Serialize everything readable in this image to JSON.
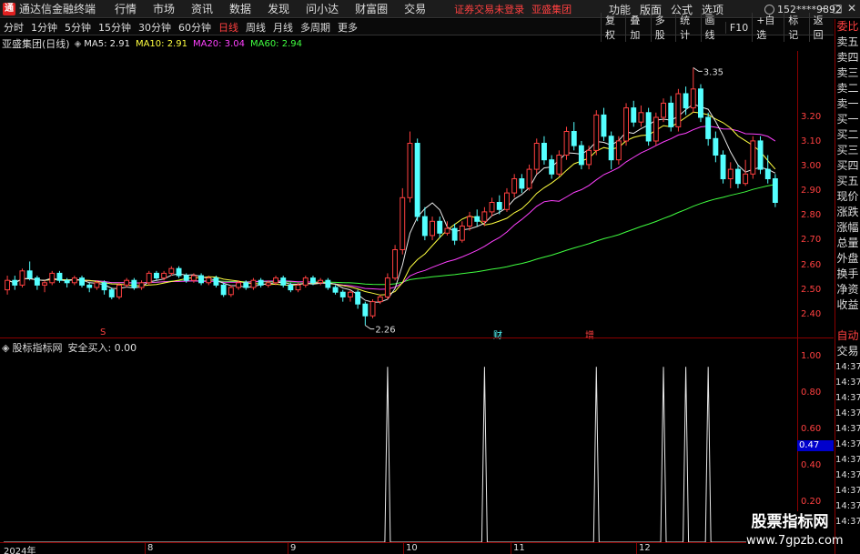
{
  "titlebar": {
    "logo": "通",
    "app_title": "通达信金融终端",
    "menu": [
      "行情",
      "市场",
      "资讯",
      "数据",
      "发现",
      "问小达",
      "财富圈",
      "交易"
    ],
    "login_status": "证券交易未登录",
    "stock_name": "亚盛集团",
    "right_menu": [
      "功能",
      "版面",
      "公式",
      "选项"
    ],
    "user_id": "152****9892",
    "window_controls": [
      "–",
      "□",
      "✕"
    ]
  },
  "toolbar": {
    "period_tabs": [
      "分时",
      "1分钟",
      "5分钟",
      "15分钟",
      "30分钟",
      "60分钟",
      "日线",
      "周线",
      "月线",
      "多周期",
      "更多"
    ],
    "active_period": "日线",
    "tool_buttons": [
      "复权",
      "叠加",
      "多股",
      "统计",
      "画线",
      "F10",
      "+自选",
      "标记",
      "返回"
    ]
  },
  "main_chart": {
    "stock_label": "亚盛集团(日线)",
    "toggle_icon": "◈",
    "ma5": "MA5: 2.91",
    "ma10": "MA10: 2.91",
    "ma20": "MA20: 3.04",
    "ma60": "MA60: 2.94",
    "price_labels": [
      "3.20",
      "3.10",
      "3.00",
      "2.90",
      "2.80",
      "2.70",
      "2.60",
      "2.50",
      "2.40"
    ],
    "high_label": "3.35",
    "low_label": "2.26",
    "events": [
      "S",
      "财",
      "增"
    ]
  },
  "indicator": {
    "toggle_icon": "◈",
    "name": "股标指标网",
    "value_label": "安全买入: 0.00",
    "axis_labels": [
      "1.00",
      "0.80",
      "0.60",
      "0.40",
      "0.20"
    ],
    "current_value": "0.47"
  },
  "date_axis": [
    "2024年",
    "8",
    "9",
    "10",
    "11",
    "12"
  ],
  "sidebar": {
    "items": [
      "委比",
      "卖五",
      "卖四",
      "卖三",
      "卖二",
      "卖一",
      "买一",
      "买二",
      "买三",
      "买四",
      "买五",
      "现价",
      "涨跌",
      "涨幅",
      "总量",
      "外盘",
      "换手",
      "净资",
      "收益",
      "",
      "自动",
      "交易"
    ],
    "times": [
      "14:37",
      "14:37",
      "14:37",
      "14:37",
      "14:37",
      "14:37",
      "14:37",
      "14:37",
      "14:37",
      "14:37",
      "14:37"
    ]
  },
  "watermark": {
    "line1": "股票指标网",
    "line2": "www.7gpzb.com"
  },
  "colors": {
    "up": "#ff4040",
    "down": "#54ffff",
    "ma5": "#e8e8e8",
    "ma10": "#ffff40",
    "ma20": "#ff40ff",
    "ma60": "#40ff40",
    "axis_red": "#8b0000"
  },
  "chart_data": [
    {
      "type": "candlestick",
      "title": "亚盛集团(日线)",
      "ylim": [
        2.22,
        3.39
      ],
      "high": 3.35,
      "low": 2.26,
      "series": [
        {
          "name": "MA5",
          "value": 2.91
        },
        {
          "name": "MA10",
          "value": 2.91
        },
        {
          "name": "MA20",
          "value": 3.04
        },
        {
          "name": "MA60",
          "value": 2.94
        }
      ],
      "candles": [
        {
          "o": 2.41,
          "c": 2.45,
          "h": 2.47,
          "l": 2.39
        },
        {
          "o": 2.45,
          "c": 2.43,
          "h": 2.47,
          "l": 2.41
        },
        {
          "o": 2.43,
          "c": 2.49,
          "h": 2.5,
          "l": 2.42
        },
        {
          "o": 2.49,
          "c": 2.46,
          "h": 2.53,
          "l": 2.45
        },
        {
          "o": 2.46,
          "c": 2.43,
          "h": 2.47,
          "l": 2.41
        },
        {
          "o": 2.43,
          "c": 2.44,
          "h": 2.45,
          "l": 2.4
        },
        {
          "o": 2.44,
          "c": 2.48,
          "h": 2.49,
          "l": 2.43
        },
        {
          "o": 2.48,
          "c": 2.45,
          "h": 2.49,
          "l": 2.44
        },
        {
          "o": 2.45,
          "c": 2.44,
          "h": 2.46,
          "l": 2.42
        },
        {
          "o": 2.44,
          "c": 2.46,
          "h": 2.47,
          "l": 2.43
        },
        {
          "o": 2.46,
          "c": 2.43,
          "h": 2.47,
          "l": 2.42
        },
        {
          "o": 2.43,
          "c": 2.42,
          "h": 2.44,
          "l": 2.4
        },
        {
          "o": 2.42,
          "c": 2.44,
          "h": 2.45,
          "l": 2.41
        },
        {
          "o": 2.44,
          "c": 2.41,
          "h": 2.45,
          "l": 2.39
        },
        {
          "o": 2.41,
          "c": 2.38,
          "h": 2.42,
          "l": 2.37
        },
        {
          "o": 2.38,
          "c": 2.43,
          "h": 2.44,
          "l": 2.37
        },
        {
          "o": 2.43,
          "c": 2.45,
          "h": 2.46,
          "l": 2.42
        },
        {
          "o": 2.45,
          "c": 2.42,
          "h": 2.46,
          "l": 2.41
        },
        {
          "o": 2.42,
          "c": 2.44,
          "h": 2.45,
          "l": 2.41
        },
        {
          "o": 2.44,
          "c": 2.48,
          "h": 2.49,
          "l": 2.43
        },
        {
          "o": 2.48,
          "c": 2.46,
          "h": 2.49,
          "l": 2.45
        },
        {
          "o": 2.46,
          "c": 2.48,
          "h": 2.49,
          "l": 2.45
        },
        {
          "o": 2.48,
          "c": 2.5,
          "h": 2.51,
          "l": 2.47
        },
        {
          "o": 2.5,
          "c": 2.47,
          "h": 2.51,
          "l": 2.46
        },
        {
          "o": 2.47,
          "c": 2.45,
          "h": 2.48,
          "l": 2.44
        },
        {
          "o": 2.45,
          "c": 2.47,
          "h": 2.48,
          "l": 2.44
        },
        {
          "o": 2.47,
          "c": 2.44,
          "h": 2.48,
          "l": 2.43
        },
        {
          "o": 2.44,
          "c": 2.46,
          "h": 2.47,
          "l": 2.43
        },
        {
          "o": 2.46,
          "c": 2.43,
          "h": 2.47,
          "l": 2.42
        },
        {
          "o": 2.43,
          "c": 2.39,
          "h": 2.44,
          "l": 2.38
        },
        {
          "o": 2.39,
          "c": 2.42,
          "h": 2.43,
          "l": 2.38
        },
        {
          "o": 2.42,
          "c": 2.44,
          "h": 2.45,
          "l": 2.41
        },
        {
          "o": 2.44,
          "c": 2.42,
          "h": 2.45,
          "l": 2.41
        },
        {
          "o": 2.42,
          "c": 2.45,
          "h": 2.46,
          "l": 2.41
        },
        {
          "o": 2.45,
          "c": 2.43,
          "h": 2.46,
          "l": 2.42
        },
        {
          "o": 2.43,
          "c": 2.44,
          "h": 2.45,
          "l": 2.42
        },
        {
          "o": 2.44,
          "c": 2.46,
          "h": 2.47,
          "l": 2.43
        },
        {
          "o": 2.46,
          "c": 2.43,
          "h": 2.47,
          "l": 2.42
        },
        {
          "o": 2.43,
          "c": 2.41,
          "h": 2.44,
          "l": 2.4
        },
        {
          "o": 2.41,
          "c": 2.43,
          "h": 2.44,
          "l": 2.4
        },
        {
          "o": 2.43,
          "c": 2.46,
          "h": 2.47,
          "l": 2.42
        },
        {
          "o": 2.46,
          "c": 2.44,
          "h": 2.47,
          "l": 2.43
        },
        {
          "o": 2.44,
          "c": 2.45,
          "h": 2.46,
          "l": 2.43
        },
        {
          "o": 2.45,
          "c": 2.42,
          "h": 2.46,
          "l": 2.41
        },
        {
          "o": 2.42,
          "c": 2.4,
          "h": 2.43,
          "l": 2.39
        },
        {
          "o": 2.4,
          "c": 2.38,
          "h": 2.41,
          "l": 2.36
        },
        {
          "o": 2.38,
          "c": 2.4,
          "h": 2.41,
          "l": 2.36
        },
        {
          "o": 2.4,
          "c": 2.35,
          "h": 2.41,
          "l": 2.33
        },
        {
          "o": 2.35,
          "c": 2.3,
          "h": 2.36,
          "l": 2.26
        },
        {
          "o": 2.3,
          "c": 2.36,
          "h": 2.37,
          "l": 2.29
        },
        {
          "o": 2.36,
          "c": 2.38,
          "h": 2.39,
          "l": 2.35
        },
        {
          "o": 2.38,
          "c": 2.46,
          "h": 2.48,
          "l": 2.37
        },
        {
          "o": 2.46,
          "c": 2.58,
          "h": 2.6,
          "l": 2.45
        },
        {
          "o": 2.58,
          "c": 2.8,
          "h": 2.84,
          "l": 2.56
        },
        {
          "o": 2.8,
          "c": 3.03,
          "h": 3.08,
          "l": 2.78
        },
        {
          "o": 3.03,
          "c": 2.72,
          "h": 3.05,
          "l": 2.7
        },
        {
          "o": 2.72,
          "c": 2.64,
          "h": 2.76,
          "l": 2.62
        },
        {
          "o": 2.64,
          "c": 2.7,
          "h": 2.72,
          "l": 2.62
        },
        {
          "o": 2.7,
          "c": 2.65,
          "h": 2.72,
          "l": 2.63
        },
        {
          "o": 2.65,
          "c": 2.67,
          "h": 2.7,
          "l": 2.64
        },
        {
          "o": 2.67,
          "c": 2.62,
          "h": 2.69,
          "l": 2.6
        },
        {
          "o": 2.62,
          "c": 2.68,
          "h": 2.7,
          "l": 2.61
        },
        {
          "o": 2.68,
          "c": 2.72,
          "h": 2.74,
          "l": 2.66
        },
        {
          "o": 2.72,
          "c": 2.7,
          "h": 2.75,
          "l": 2.68
        },
        {
          "o": 2.7,
          "c": 2.74,
          "h": 2.76,
          "l": 2.68
        },
        {
          "o": 2.74,
          "c": 2.78,
          "h": 2.8,
          "l": 2.72
        },
        {
          "o": 2.78,
          "c": 2.75,
          "h": 2.81,
          "l": 2.73
        },
        {
          "o": 2.75,
          "c": 2.82,
          "h": 2.84,
          "l": 2.74
        },
        {
          "o": 2.82,
          "c": 2.88,
          "h": 2.9,
          "l": 2.8
        },
        {
          "o": 2.88,
          "c": 2.84,
          "h": 2.9,
          "l": 2.82
        },
        {
          "o": 2.84,
          "c": 2.92,
          "h": 2.94,
          "l": 2.83
        },
        {
          "o": 2.92,
          "c": 3.03,
          "h": 3.05,
          "l": 2.9
        },
        {
          "o": 3.03,
          "c": 2.96,
          "h": 3.06,
          "l": 2.94
        },
        {
          "o": 2.96,
          "c": 2.9,
          "h": 2.98,
          "l": 2.88
        },
        {
          "o": 2.9,
          "c": 2.98,
          "h": 3.0,
          "l": 2.89
        },
        {
          "o": 2.98,
          "c": 3.08,
          "h": 3.1,
          "l": 2.96
        },
        {
          "o": 3.08,
          "c": 3.02,
          "h": 3.12,
          "l": 3.0
        },
        {
          "o": 3.02,
          "c": 2.94,
          "h": 3.04,
          "l": 2.92
        },
        {
          "o": 2.94,
          "c": 3.0,
          "h": 3.02,
          "l": 2.92
        },
        {
          "o": 3.0,
          "c": 3.15,
          "h": 3.17,
          "l": 2.98
        },
        {
          "o": 3.15,
          "c": 3.06,
          "h": 3.18,
          "l": 3.04
        },
        {
          "o": 3.06,
          "c": 2.96,
          "h": 3.08,
          "l": 2.92
        },
        {
          "o": 2.96,
          "c": 3.04,
          "h": 3.06,
          "l": 2.94
        },
        {
          "o": 3.04,
          "c": 3.18,
          "h": 3.2,
          "l": 3.02
        },
        {
          "o": 3.18,
          "c": 3.12,
          "h": 3.21,
          "l": 3.1
        },
        {
          "o": 3.12,
          "c": 3.16,
          "h": 3.19,
          "l": 3.1
        },
        {
          "o": 3.16,
          "c": 3.04,
          "h": 3.18,
          "l": 3.02
        },
        {
          "o": 3.04,
          "c": 3.14,
          "h": 3.16,
          "l": 3.02
        },
        {
          "o": 3.14,
          "c": 3.2,
          "h": 3.22,
          "l": 3.12
        },
        {
          "o": 3.2,
          "c": 3.1,
          "h": 3.23,
          "l": 3.08
        },
        {
          "o": 3.1,
          "c": 3.24,
          "h": 3.26,
          "l": 3.08
        },
        {
          "o": 3.24,
          "c": 3.18,
          "h": 3.27,
          "l": 3.15
        },
        {
          "o": 3.18,
          "c": 3.26,
          "h": 3.35,
          "l": 3.16
        },
        {
          "o": 3.26,
          "c": 3.14,
          "h": 3.28,
          "l": 3.12
        },
        {
          "o": 3.14,
          "c": 3.05,
          "h": 3.16,
          "l": 3.02
        },
        {
          "o": 3.05,
          "c": 2.98,
          "h": 3.08,
          "l": 2.95
        },
        {
          "o": 2.98,
          "c": 2.88,
          "h": 3.0,
          "l": 2.86
        },
        {
          "o": 2.88,
          "c": 2.92,
          "h": 2.95,
          "l": 2.84
        },
        {
          "o": 2.92,
          "c": 2.86,
          "h": 2.94,
          "l": 2.84
        },
        {
          "o": 2.86,
          "c": 2.9,
          "h": 2.96,
          "l": 2.85
        },
        {
          "o": 2.9,
          "c": 3.04,
          "h": 3.06,
          "l": 2.88
        },
        {
          "o": 3.04,
          "c": 2.92,
          "h": 3.06,
          "l": 2.9
        },
        {
          "o": 2.92,
          "c": 2.88,
          "h": 2.98,
          "l": 2.86
        },
        {
          "o": 2.88,
          "c": 2.78,
          "h": 2.9,
          "l": 2.76
        }
      ]
    },
    {
      "type": "line",
      "title": "股标指标网 安全买入",
      "ylim": [
        0,
        1.1
      ],
      "series": [
        {
          "name": "安全买入",
          "value": 0.0
        }
      ],
      "spikes_at_index": [
        51,
        64,
        79,
        88,
        91,
        94
      ],
      "spike_value": 1.0
    }
  ]
}
